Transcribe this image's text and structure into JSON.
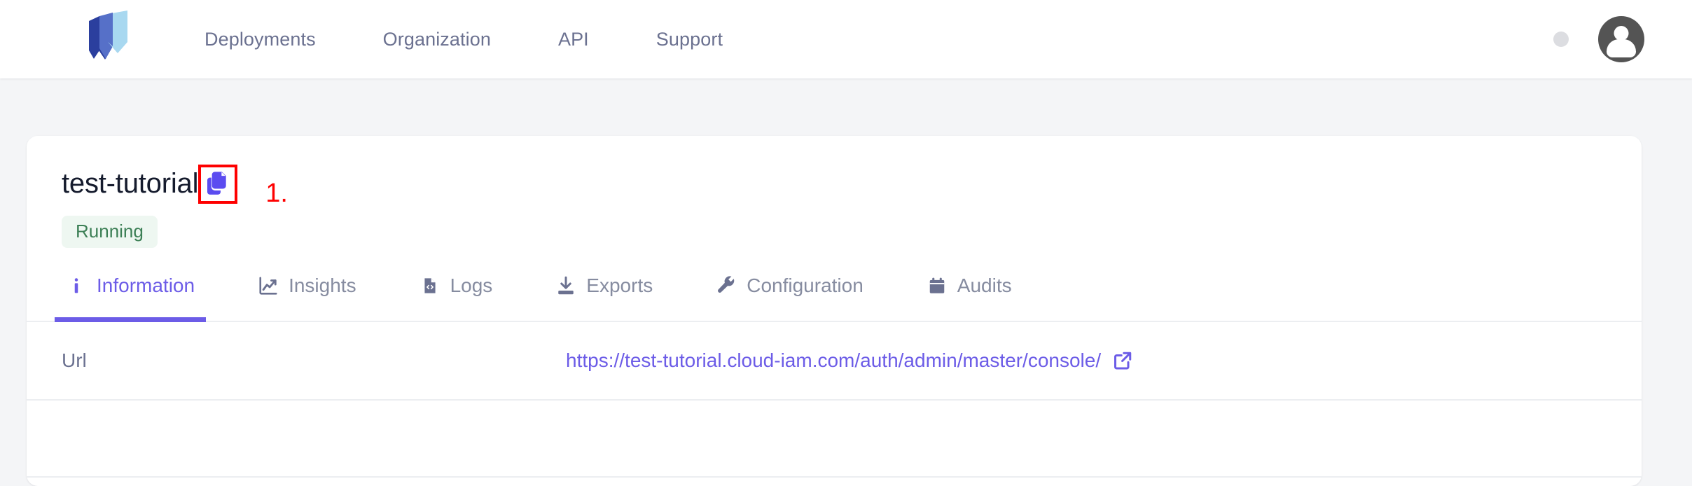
{
  "topbar": {
    "logo_name": "cloud-iam-logo",
    "nav": [
      {
        "label": "Deployments",
        "name": "nav-deployments"
      },
      {
        "label": "Organization",
        "name": "nav-organization"
      },
      {
        "label": "API",
        "name": "nav-api"
      },
      {
        "label": "Support",
        "name": "nav-support"
      }
    ],
    "status_dot": "status-dot",
    "avatar": "account-avatar"
  },
  "deployment": {
    "title": "test-tutorial",
    "copy_icon": "copy-icon",
    "annotation": "1.",
    "status_badge": "Running"
  },
  "tabs": [
    {
      "label": "Information",
      "icon": "info-icon",
      "active": true
    },
    {
      "label": "Insights",
      "icon": "chart-line-icon",
      "active": false
    },
    {
      "label": "Logs",
      "icon": "file-code-icon",
      "active": false
    },
    {
      "label": "Exports",
      "icon": "download-icon",
      "active": false
    },
    {
      "label": "Configuration",
      "icon": "wrench-icon",
      "active": false
    },
    {
      "label": "Audits",
      "icon": "calendar-icon",
      "active": false
    }
  ],
  "info": {
    "rows": [
      {
        "label": "Url",
        "value": "https://test-tutorial.cloud-iam.com/auth/admin/master/console/",
        "external_icon": "external-link-icon"
      }
    ]
  },
  "colors": {
    "accent": "#6c5ce7",
    "page_bg": "#f4f5f7",
    "card_bg": "#ffffff",
    "muted_text": "#6b7190",
    "title_text": "#151b2d",
    "badge_bg": "#eef7f1",
    "badge_text": "#3c7f55",
    "annotation_red": "#fe0000",
    "divider": "#eceef1"
  }
}
